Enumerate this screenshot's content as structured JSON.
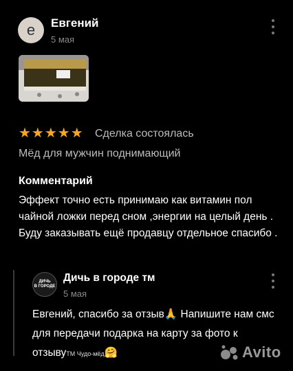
{
  "review": {
    "avatar_letter": "e",
    "author": "Евгений",
    "date": "5 мая",
    "stars": "★★★★★",
    "status": "Сделка состоялась",
    "product": "Мёд для мужчин поднимающий",
    "comment_heading": "Комментарий",
    "comment_text": "Эффект точно есть принимаю как витамин пол чайной ложки перед сном ,энергии на целый день . Буду заказывать ещё продавцу отдельное спасибо ."
  },
  "reply": {
    "seller_avatar_line1": "ДИЧЬ",
    "seller_avatar_line2": "В ГОРОДЕ",
    "seller_name": "Дичь в городе тм",
    "date": "5 мая",
    "text_part1": "Евгений, спасибо за отзыв",
    "emoji1": "🙏",
    "text_part2": " Напишите нам смс для передачи подарка на карту за фото к отзыву",
    "watermark": "ТМ Чудо-мёд",
    "emoji2": "🤗"
  },
  "watermark": {
    "brand": "Avito"
  },
  "colors": {
    "background": "#000000",
    "stars": "#f5a623",
    "muted": "#8a8a8a"
  },
  "icons": [
    "more-vertical-icon",
    "star-icon",
    "avito-logo-icon"
  ]
}
